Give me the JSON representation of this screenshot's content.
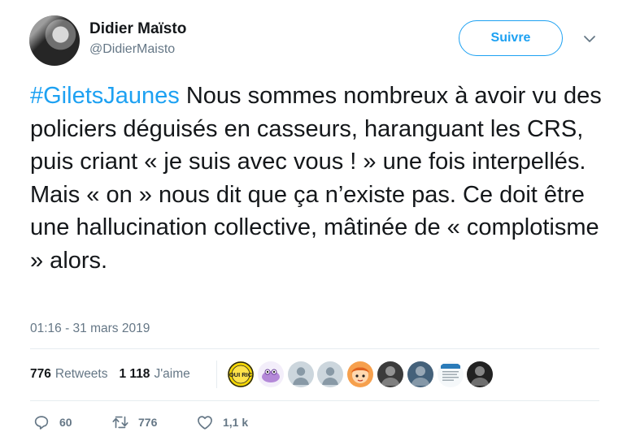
{
  "author": {
    "name": "Didier Maïsto",
    "handle": "@DidierMaisto"
  },
  "follow_label": "Suivre",
  "tweet": {
    "hashtag": "#GiletsJaunes",
    "body": " Nous sommes nombreux à avoir vu des policiers déguisés en casseurs, haranguant les CRS, puis criant « je suis avec vous ! » une fois interpellés. Mais « on » nous dit que ça n’existe pas. Ce doit être une hallucination collective, mâtinée de « complotisme » alors."
  },
  "timestamp": "01:16 - 31 mars 2019",
  "stats": {
    "retweets_count": "776",
    "retweets_label": "Retweets",
    "likes_count": "1 118",
    "likes_label": "J'aime"
  },
  "liker_avatars": [
    {
      "icon": "badge-avatar",
      "text": "OUI RIC",
      "bg": "#f4d600"
    },
    {
      "icon": "cartoon-avatar",
      "bg": "#f3eefa"
    },
    {
      "icon": "default-person-avatar",
      "bg": "#ccd6dd"
    },
    {
      "icon": "default-person-avatar",
      "bg": "#ccd6dd"
    },
    {
      "icon": "cartoon-avatar",
      "bg": "#f6a04d"
    },
    {
      "icon": "photo-avatar",
      "bg": "#3b3b3b"
    },
    {
      "icon": "photo-avatar",
      "bg": "#44617a"
    },
    {
      "icon": "document-avatar",
      "bg": "#f5f8fa"
    },
    {
      "icon": "photo-avatar",
      "bg": "#222222"
    }
  ],
  "actions": {
    "replies": "60",
    "retweets": "776",
    "likes": "1,1 k"
  },
  "colors": {
    "accent": "#1da1f2",
    "secondary_text": "#657786",
    "divider": "#e6ecf0"
  }
}
